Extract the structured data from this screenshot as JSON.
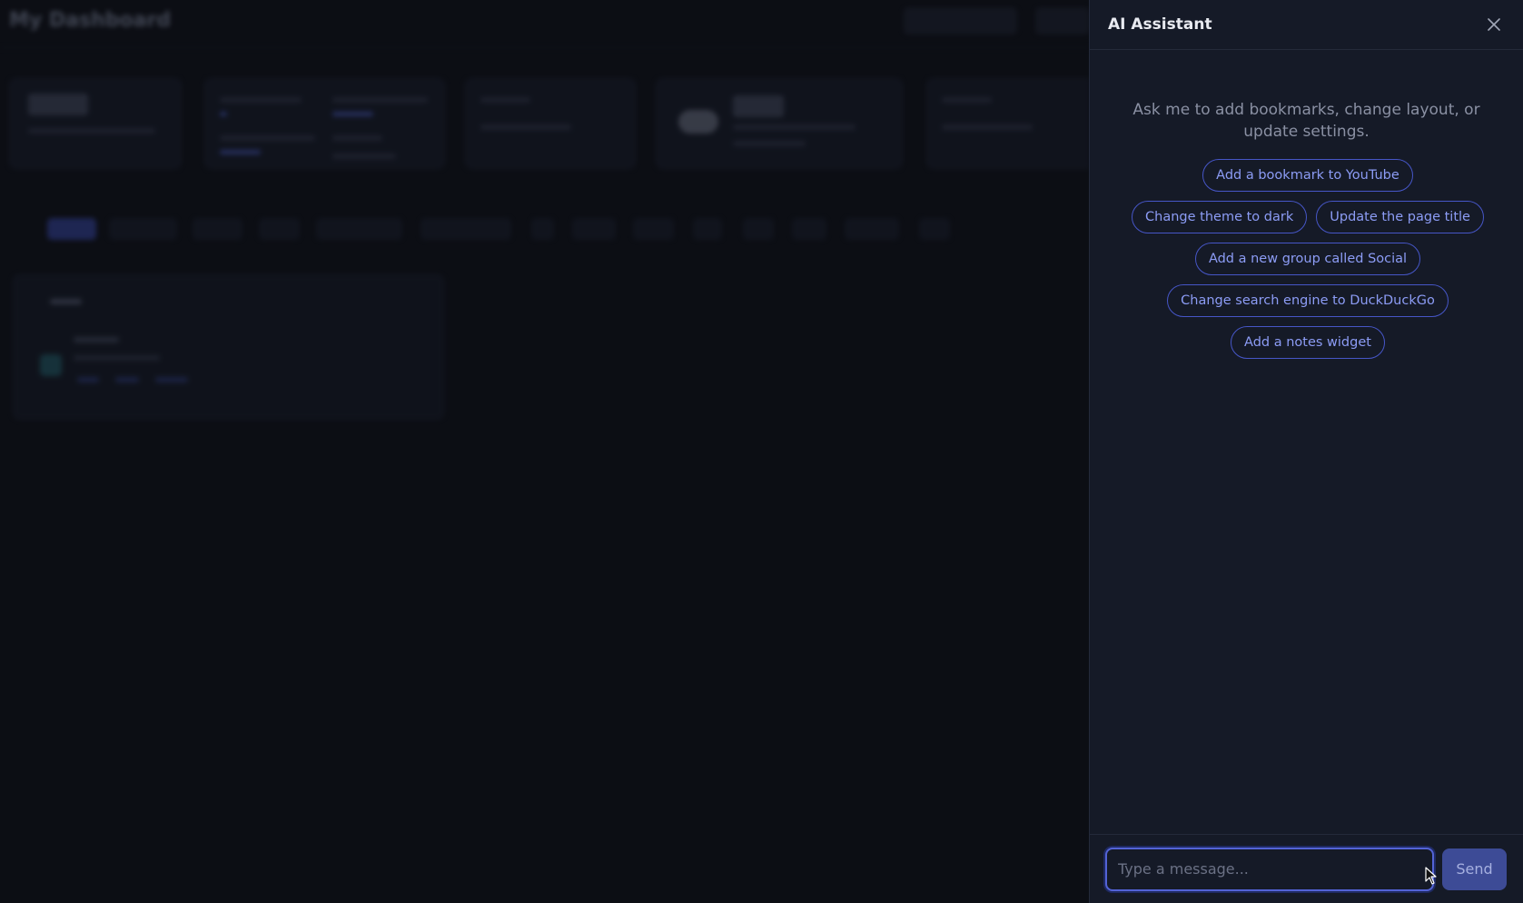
{
  "backdrop": {
    "title": "My Dashboard"
  },
  "assistant": {
    "title": "AI Assistant",
    "intro": "Ask me to add bookmarks, change layout, or update settings.",
    "suggestions": [
      "Add a bookmark to YouTube",
      "Change theme to dark",
      "Update the page title",
      "Add a new group called Social",
      "Change search engine to DuckDuckGo",
      "Add a notes widget"
    ],
    "composer": {
      "placeholder": "Type a message...",
      "value": "",
      "send_label": "Send"
    }
  },
  "colors": {
    "accent": "#4656c7",
    "panel_bg": "#151a27",
    "page_bg": "#0c0e14"
  }
}
